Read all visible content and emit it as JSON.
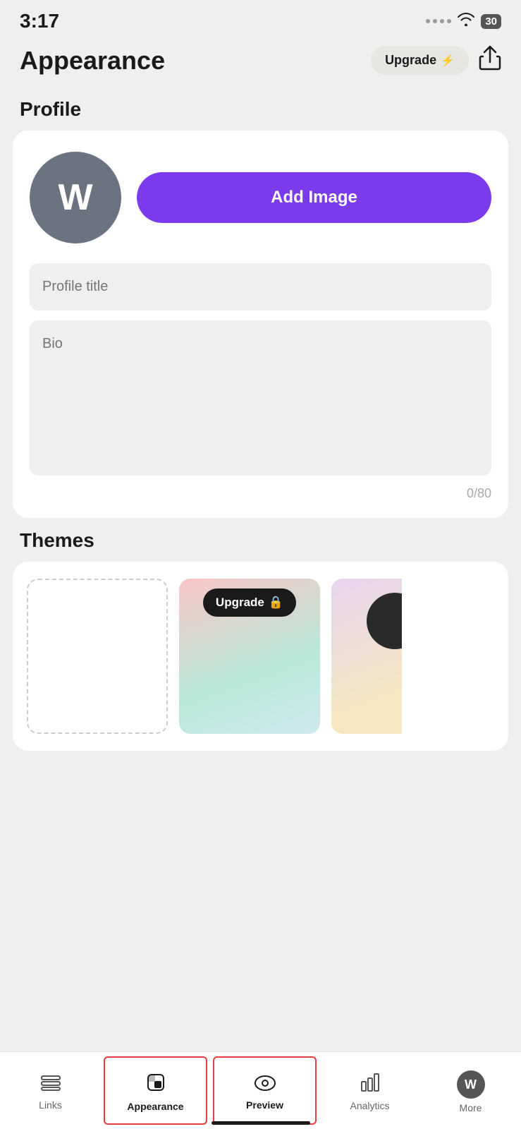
{
  "statusBar": {
    "time": "3:17",
    "batteryLevel": "30"
  },
  "header": {
    "title": "Appearance",
    "upgradeLabel": "Upgrade",
    "shareIconName": "share-icon"
  },
  "profile": {
    "sectionLabel": "Profile",
    "avatarLetter": "W",
    "addImageLabel": "Add Image",
    "titlePlaceholder": "Profile title",
    "bioPlaceholder": "Bio",
    "charCount": "0/80"
  },
  "themes": {
    "sectionLabel": "Themes",
    "upgradeLabel": "Upgrade"
  },
  "bottomNav": {
    "items": [
      {
        "id": "links",
        "label": "Links",
        "icon": "links-icon"
      },
      {
        "id": "appearance",
        "label": "Appearance",
        "icon": "appearance-icon",
        "active": true
      },
      {
        "id": "preview",
        "label": "Preview",
        "icon": "preview-icon",
        "active": true
      },
      {
        "id": "analytics",
        "label": "Analytics",
        "icon": "analytics-icon"
      },
      {
        "id": "more",
        "label": "More",
        "icon": "more-icon"
      }
    ]
  }
}
